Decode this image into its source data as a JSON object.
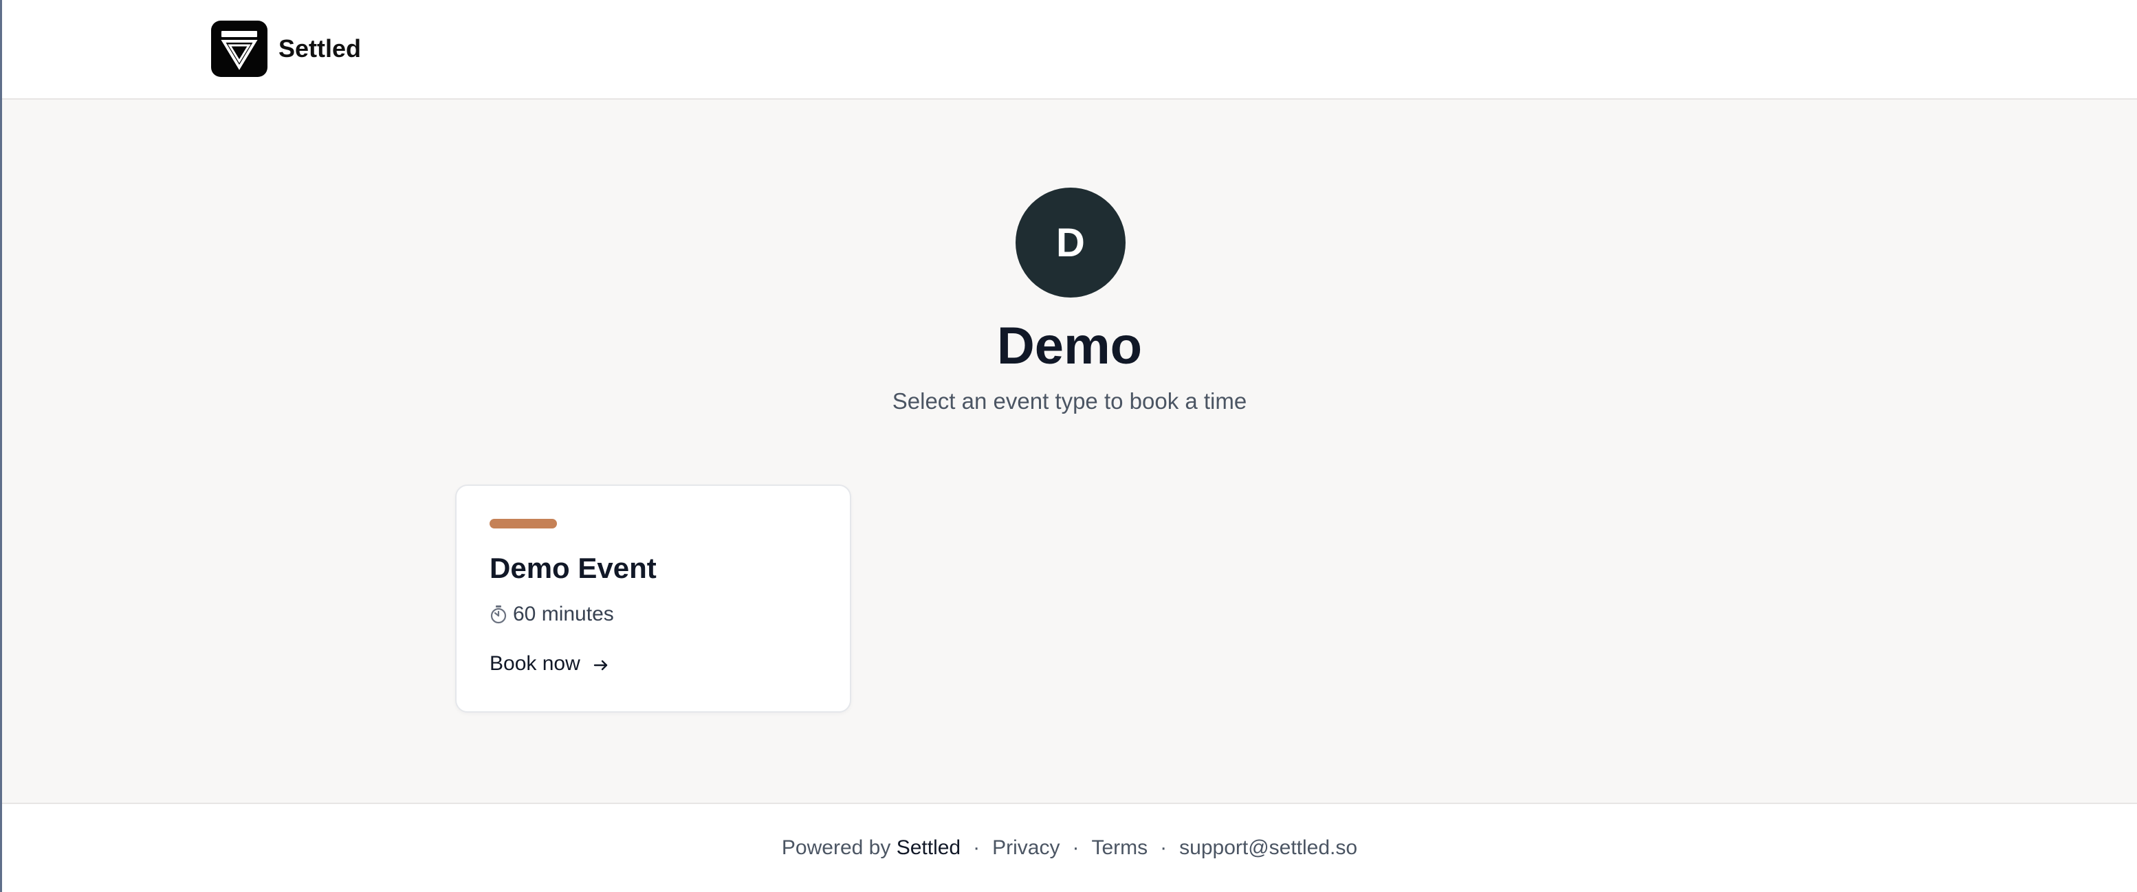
{
  "header": {
    "brand_name": "Settled"
  },
  "profile": {
    "avatar_initial": "D",
    "name": "Demo",
    "subtitle": "Select an event type to book a time"
  },
  "event": {
    "title": "Demo Event",
    "duration": "60 minutes",
    "action": "Book now"
  },
  "footer": {
    "powered_by": "Powered by",
    "brand": "Settled",
    "separator": "·",
    "privacy": "Privacy",
    "terms": "Terms",
    "email": "support@settled.so"
  },
  "colors": {
    "accent": "#c58156",
    "avatar": "#1f2d32",
    "logo": "#050505"
  },
  "icons": {
    "brand": "settled-logo-icon",
    "duration": "clock-icon",
    "action": "arrow-right-icon"
  }
}
